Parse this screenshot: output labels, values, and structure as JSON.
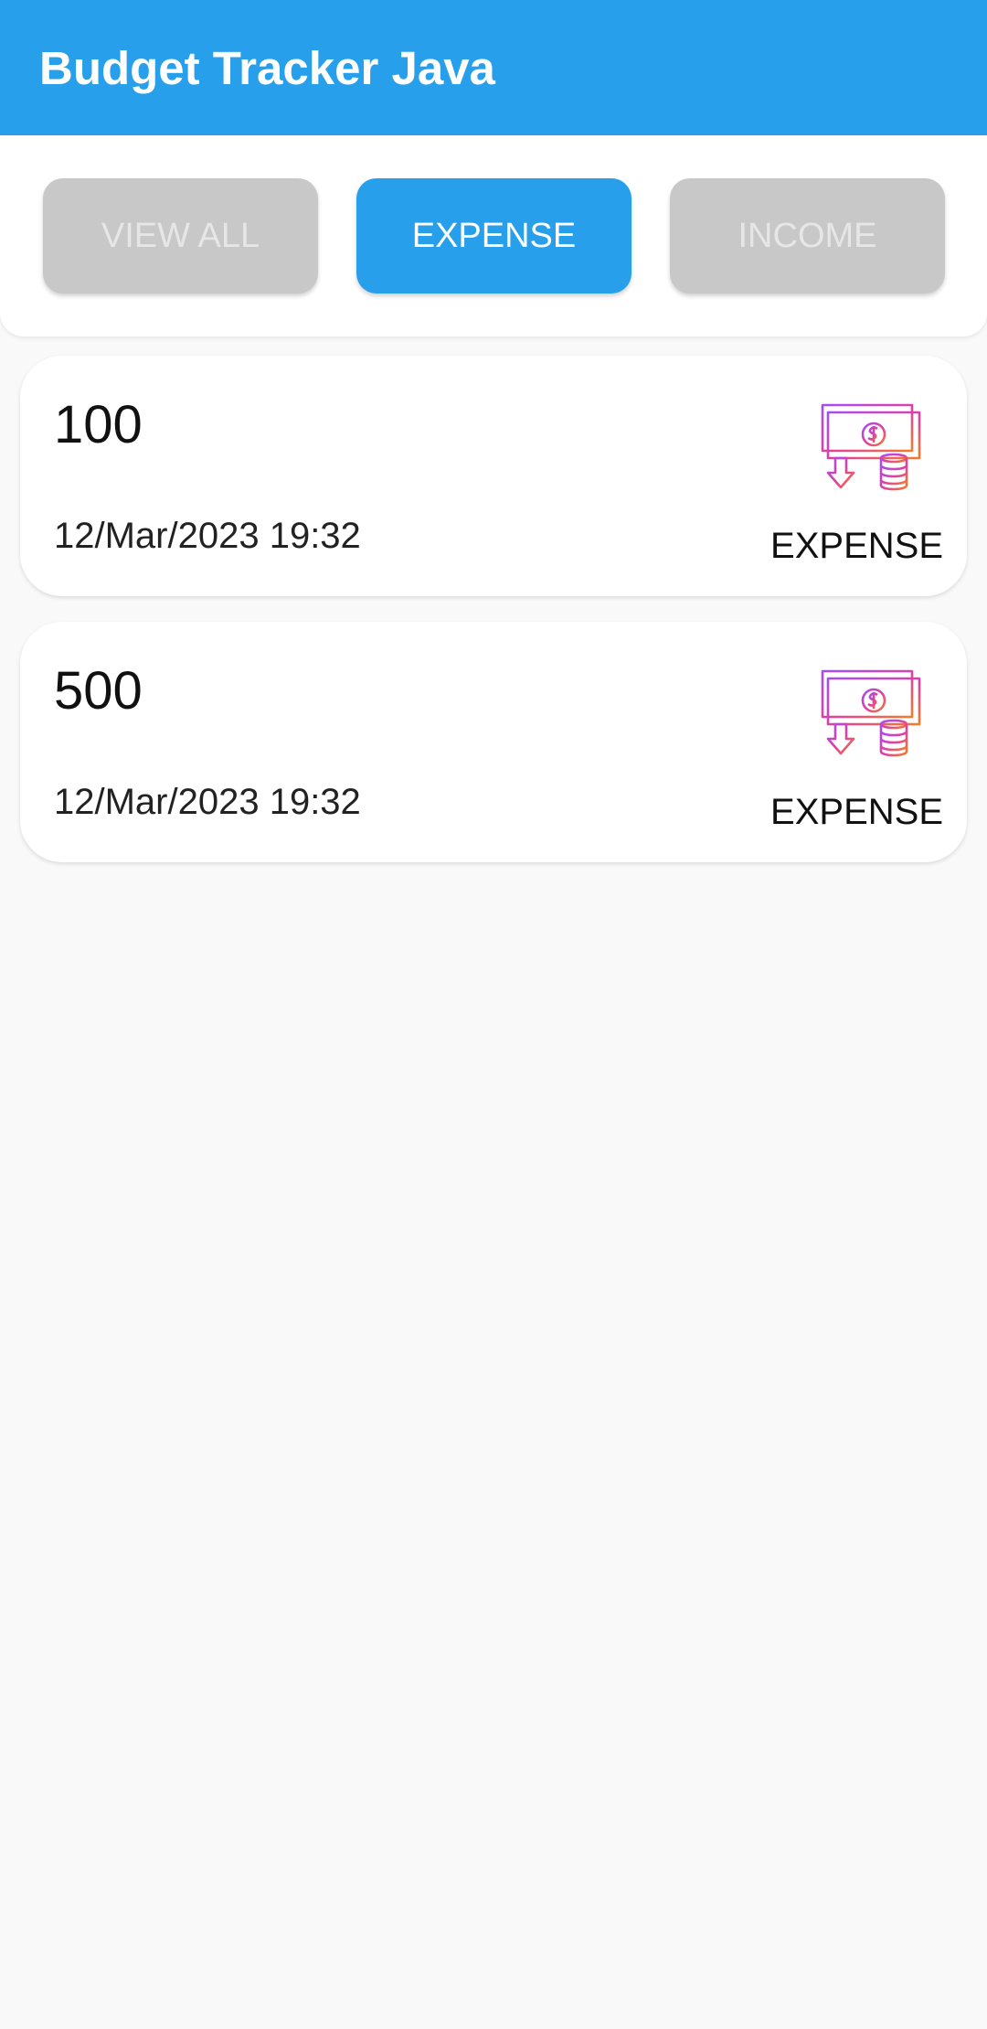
{
  "app": {
    "title": "Budget Tracker Java"
  },
  "filters": {
    "view_all": "VIEW ALL",
    "expense": "EXPENSE",
    "income": "INCOME",
    "selected": "expense"
  },
  "colors": {
    "primary": "#279fea",
    "inactive_button": "#c8c8c8",
    "background": "#f9f9f9"
  },
  "transactions": [
    {
      "amount": "100",
      "date": "12/Mar/2023 19:32",
      "type": "EXPENSE",
      "icon": "money-expense-icon"
    },
    {
      "amount": "500",
      "date": "12/Mar/2023 19:32",
      "type": "EXPENSE",
      "icon": "money-expense-icon"
    }
  ]
}
